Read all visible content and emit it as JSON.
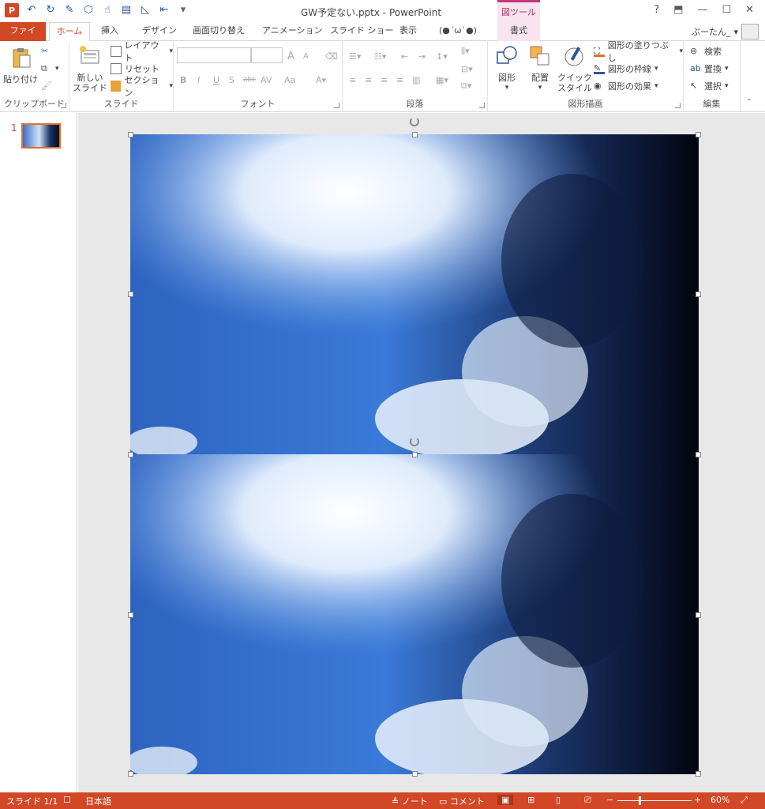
{
  "window": {
    "title": "GW予定ない.pptx - PowerPoint",
    "context_tab_header": "図ツール",
    "help": "?",
    "restore_ribbon": "⬒",
    "minimize": "—",
    "maximize": "☐",
    "close": "✕",
    "user_name": "ぶーたん_"
  },
  "tabs": [
    {
      "label": "ファイル"
    },
    {
      "label": "ホーム"
    },
    {
      "label": "挿入"
    },
    {
      "label": "デザイン"
    },
    {
      "label": "画面切り替え"
    },
    {
      "label": "アニメーション"
    },
    {
      "label": "スライド ショー"
    },
    {
      "label": "表示"
    },
    {
      "label": "(●´ω`●)"
    },
    {
      "label": "書式"
    }
  ],
  "ribbon": {
    "clipboard": {
      "label": "クリップボード",
      "paste": "貼り付け"
    },
    "slides": {
      "label": "スライド",
      "new_slide_line1": "新しい",
      "new_slide_line2": "スライド",
      "layout": "レイアウト",
      "reset": "リセット",
      "section": "セクション"
    },
    "font": {
      "label": "フォント",
      "bold": "B",
      "italic": "I",
      "underline": "U",
      "shadow": "S",
      "strike": "abc",
      "spacing": "AV",
      "case": "Aa",
      "grow": "A",
      "shrink": "A"
    },
    "paragraph": {
      "label": "段落"
    },
    "drawing": {
      "label": "図形描画",
      "shapes": "図形",
      "arrange": "配置",
      "quick_style_line1": "クイック",
      "quick_style_line2": "スタイル",
      "fill": "図形の塗りつぶし",
      "outline": "図形の枠線",
      "effects": "図形の効果"
    },
    "editing": {
      "label": "編集",
      "find": "検索",
      "replace": "置換",
      "select": "選択"
    }
  },
  "slides_panel": {
    "slide_number": "1"
  },
  "status": {
    "slide_info": "スライド 1/1",
    "language": "日本語",
    "notes": "ノート",
    "comments": "コメント",
    "zoom_pct": "60%",
    "zoom_level": 0.6
  },
  "colors": {
    "accent": "#d24726",
    "context": "#b0306c"
  }
}
